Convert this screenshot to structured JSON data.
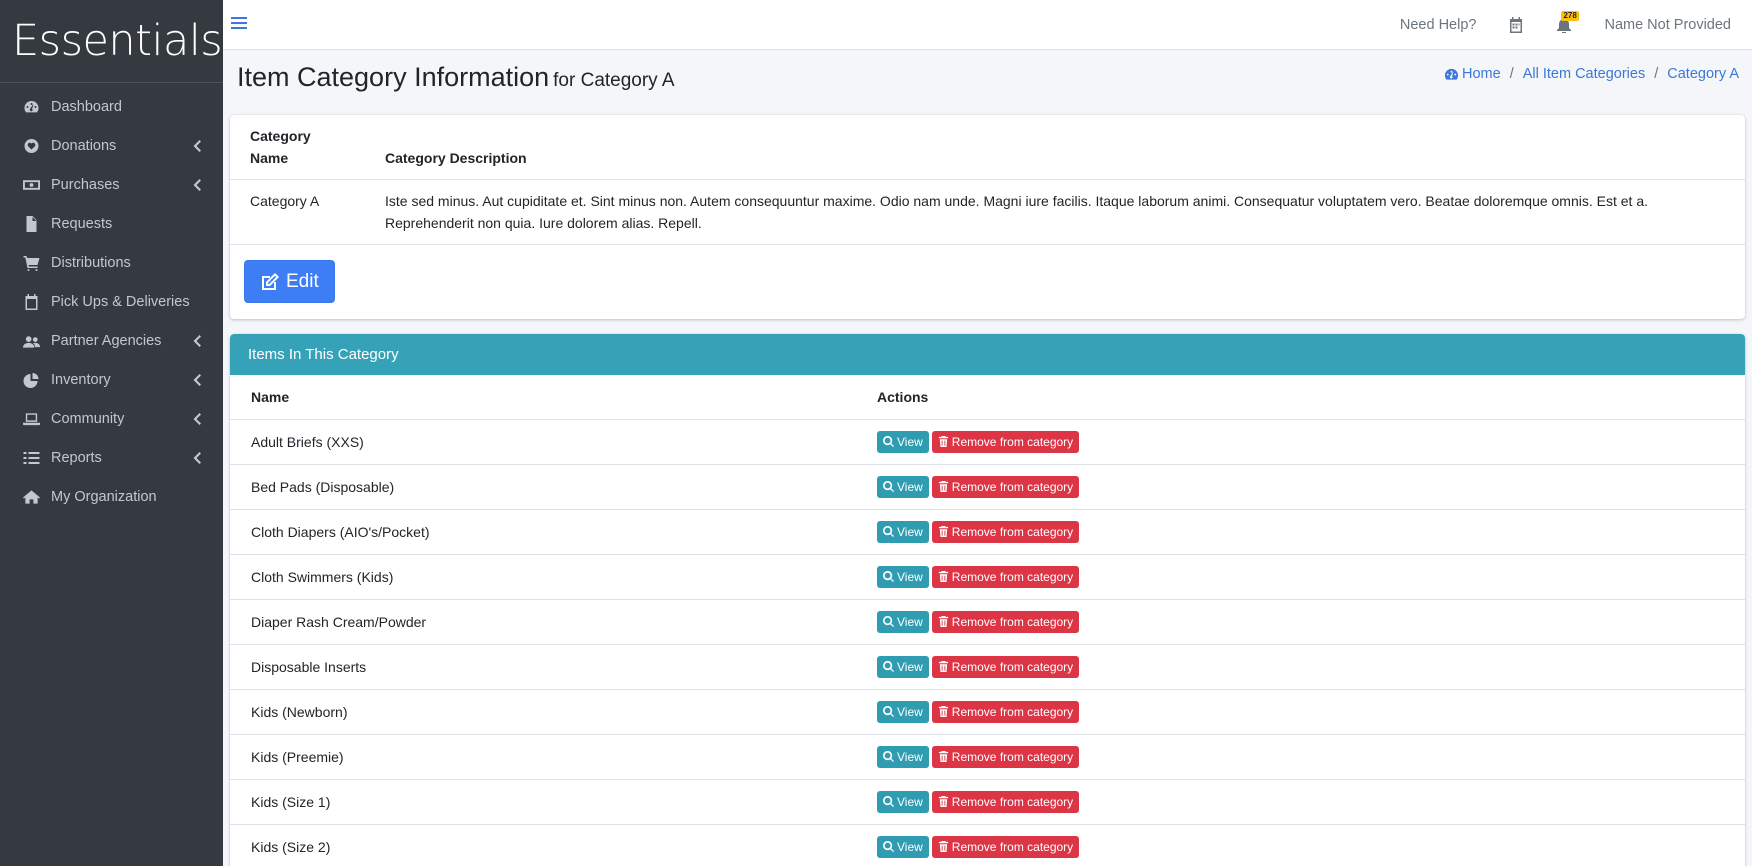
{
  "brand": {
    "name": "Essentials"
  },
  "sidebar": {
    "items": [
      {
        "label": "Dashboard",
        "icon": "dashboard-icon",
        "has_children": false
      },
      {
        "label": "Donations",
        "icon": "heart-icon",
        "has_children": true
      },
      {
        "label": "Purchases",
        "icon": "money-icon",
        "has_children": true
      },
      {
        "label": "Requests",
        "icon": "file-icon",
        "has_children": false
      },
      {
        "label": "Distributions",
        "icon": "cart-icon",
        "has_children": false
      },
      {
        "label": "Pick Ups & Deliveries",
        "icon": "calendar-icon",
        "has_children": false
      },
      {
        "label": "Partner Agencies",
        "icon": "users-icon",
        "has_children": true
      },
      {
        "label": "Inventory",
        "icon": "pie-chart-icon",
        "has_children": true
      },
      {
        "label": "Community",
        "icon": "laptop-icon",
        "has_children": true
      },
      {
        "label": "Reports",
        "icon": "list-icon",
        "has_children": true
      },
      {
        "label": "My Organization",
        "icon": "home-icon",
        "has_children": false
      }
    ]
  },
  "topbar": {
    "help_label": "Need Help?",
    "notification_count": "278",
    "user_name": "Name Not Provided"
  },
  "header": {
    "title": "Item Category Information",
    "subtitle": "for Category A",
    "breadcrumb": [
      "Home",
      "All Item Categories",
      "Category A"
    ]
  },
  "category": {
    "headers": {
      "name": "Category Name",
      "description": "Category Description"
    },
    "name": "Category A",
    "description": "Iste sed minus. Aut cupiditate et. Sint minus non. Autem consequuntur maxime. Odio nam unde. Magni iure facilis. Itaque laborum animi. Consequatur voluptatem vero. Beatae doloremque omnis. Est et a. Reprehenderit non quia. Iure dolorem alias. Repell.",
    "edit_label": "Edit"
  },
  "items": {
    "card_title": "Items In This Category",
    "headers": {
      "name": "Name",
      "actions": "Actions"
    },
    "view_label": "View",
    "remove_label": "Remove from category",
    "rows": [
      "Adult Briefs (XXS)",
      "Bed Pads (Disposable)",
      "Cloth Diapers (AIO's/Pocket)",
      "Cloth Swimmers (Kids)",
      "Diaper Rash Cream/Powder",
      "Disposable Inserts",
      "Kids (Newborn)",
      "Kids (Preemie)",
      "Kids (Size 1)",
      "Kids (Size 2)"
    ]
  },
  "colors": {
    "sidebar_bg": "#343a40",
    "link": "#3c78d8",
    "primary": "#3d7ef5",
    "info": "#36a2b8",
    "danger": "#dc3545"
  }
}
